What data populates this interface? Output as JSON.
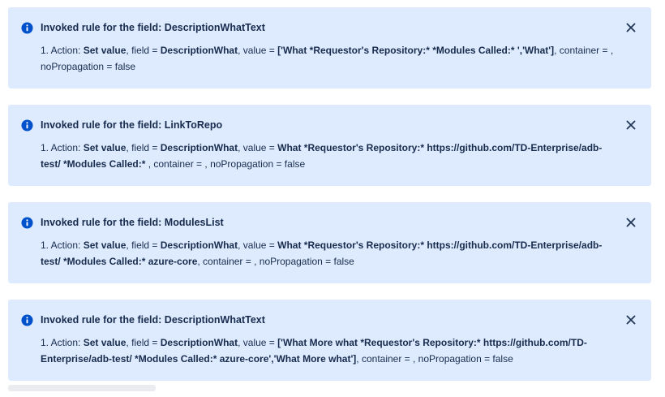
{
  "colors": {
    "flag_background": "#deebff",
    "icon": "#0052cc",
    "text": "#172b4d"
  },
  "flags": [
    {
      "icon": "info-icon",
      "title": "Invoked rule for the field: DescriptionWhatText",
      "body": {
        "prefix": "1. Action: ",
        "action": "Set value",
        "sep1": ", field = ",
        "field": "DescriptionWhat",
        "sep2": ", value = ",
        "value": "['What *Requestor's Repository:* *Modules Called:* ','What']",
        "suffix": ", container = , noPropagation = false"
      },
      "close_icon": "close-icon"
    },
    {
      "icon": "info-icon",
      "title": "Invoked rule for the field: LinkToRepo",
      "body": {
        "prefix": "1. Action: ",
        "action": "Set value",
        "sep1": ", field = ",
        "field": "DescriptionWhat",
        "sep2": ", value = ",
        "value": "What *Requestor's Repository:* https://github.com/TD-Enterprise/adb-test/ *Modules Called:*",
        "suffix": " , container = , noPropagation = false"
      },
      "close_icon": "close-icon"
    },
    {
      "icon": "info-icon",
      "title": "Invoked rule for the field: ModulesList",
      "body": {
        "prefix": "1. Action: ",
        "action": "Set value",
        "sep1": ", field = ",
        "field": "DescriptionWhat",
        "sep2": ", value = ",
        "value": "What *Requestor's Repository:* https://github.com/TD-Enterprise/adb-test/ *Modules Called:* azure-core",
        "suffix": ", container = , noPropagation = false"
      },
      "close_icon": "close-icon"
    },
    {
      "icon": "info-icon",
      "title": "Invoked rule for the field: DescriptionWhatText",
      "body": {
        "prefix": "1. Action: ",
        "action": "Set value",
        "sep1": ", field = ",
        "field": "DescriptionWhat",
        "sep2": ", value = ",
        "value": "['What More what *Requestor's Repository:* https://github.com/TD-Enterprise/adb-test/ *Modules Called:* azure-core','What More what']",
        "suffix": ", container = , noPropagation = false"
      },
      "close_icon": "close-icon"
    }
  ]
}
